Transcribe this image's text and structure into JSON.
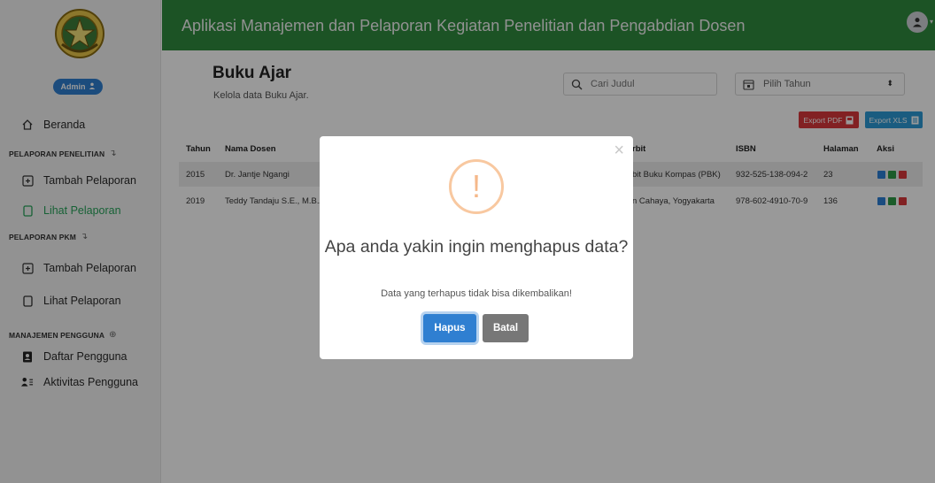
{
  "header": {
    "title": "Aplikasi Manajemen dan Pelaporan Kegiatan Penelitian dan Pengabdian Dosen",
    "bg": "#2f8a3e"
  },
  "sidebar": {
    "admin_label": "Admin",
    "home": "Beranda",
    "sections": [
      {
        "title": "PELAPORAN PENELITIAN",
        "items": [
          "Tambah Pelaporan",
          "Lihat Pelaporan"
        ]
      },
      {
        "title": "PELAPORAN PKM",
        "items": [
          "Tambah Pelaporan",
          "Lihat Pelaporan"
        ]
      },
      {
        "title": "MANAJEMEN PENGGUNA",
        "items": [
          "Daftar Pengguna",
          "Aktivitas Pengguna"
        ]
      }
    ]
  },
  "page": {
    "title": "Buku Ajar",
    "subtitle": "Kelola data Buku Ajar.",
    "search_placeholder": "Cari Judul",
    "year_placeholder": "Pilih Tahun",
    "export_pdf": "Export PDF",
    "export_xls": "Export XLS"
  },
  "table": {
    "columns": [
      "Tahun",
      "Nama Dosen",
      "rbit",
      "ISBN",
      "Halaman",
      "Aksi"
    ],
    "rows": [
      {
        "tahun": "2015",
        "dosen": "Dr. Jantje Ngangi",
        "penerbit": "bit Buku Kompas (PBK)",
        "isbn": "932-525-138-094-2",
        "halaman": "23"
      },
      {
        "tahun": "2019",
        "dosen": "Teddy Tandaju S.E., M.B.A",
        "penerbit": "n Cahaya, Yogyakarta",
        "isbn": "978-602-4910-70-9",
        "halaman": "136"
      }
    ]
  },
  "modal": {
    "icon": "!",
    "title": "Apa anda yakin ingin menghapus data?",
    "text": "Data yang terhapus tidak bisa dikembalikan!",
    "confirm": "Hapus",
    "cancel": "Batal",
    "close": "×"
  },
  "colors": {
    "accent": "#2f7fd1",
    "active_nav": "#27a35a",
    "danger": "#d9383b",
    "xls": "#2c9ad6"
  }
}
